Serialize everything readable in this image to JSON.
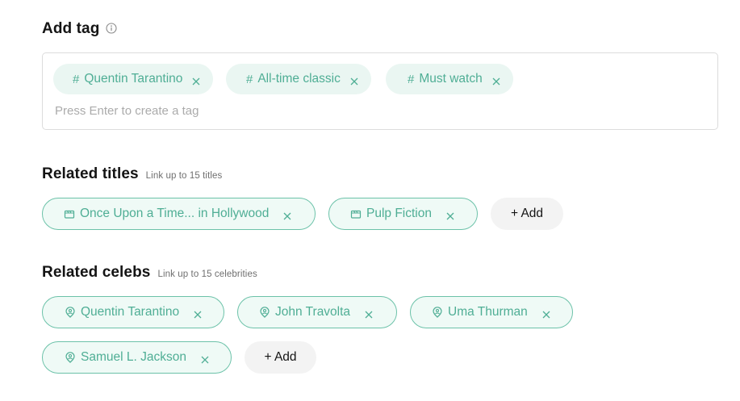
{
  "add_tag": {
    "title": "Add tag",
    "icon": "info-icon",
    "input": {
      "value": "",
      "placeholder": "Press Enter to create a tag"
    },
    "tags": [
      {
        "label": "Quentin Tarantino"
      },
      {
        "label": "All-time classic"
      },
      {
        "label": "Must watch"
      }
    ]
  },
  "related_titles": {
    "title": "Related titles",
    "subtitle": "Link up to 15 titles",
    "item_icon": "clapperboard-icon",
    "items": [
      {
        "label": "Once Upon a Time... in Hollywood"
      },
      {
        "label": "Pulp Fiction"
      }
    ],
    "add_label": "+ Add"
  },
  "related_celebs": {
    "title": "Related celebs",
    "subtitle": "Link up to 15 celebrities",
    "item_icon": "person-pin-icon",
    "items": [
      {
        "label": "Quentin Tarantino"
      },
      {
        "label": "John Travolta"
      },
      {
        "label": "Uma Thurman"
      },
      {
        "label": "Samuel L. Jackson"
      }
    ],
    "add_label": "+ Add"
  },
  "colors": {
    "accent": "#4fae95",
    "chip_border": "#6cc2a9",
    "chip_fill": "#eaf6f2",
    "add_button_bg": "#f3f3f3"
  }
}
